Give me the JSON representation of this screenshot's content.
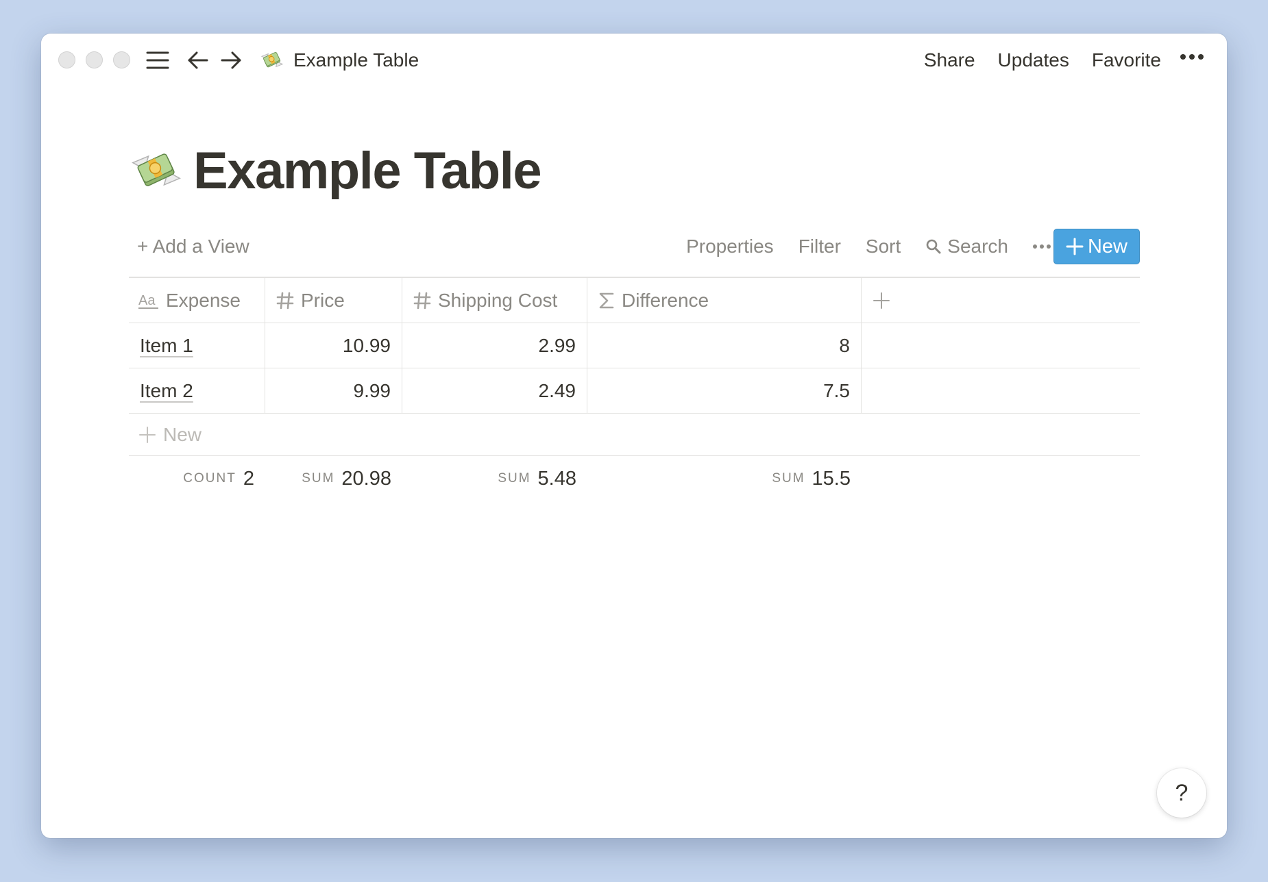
{
  "titlebar": {
    "page_emoji": "money-with-wings",
    "breadcrumb_title": "Example Table",
    "actions": {
      "share": "Share",
      "updates": "Updates",
      "favorite": "Favorite"
    }
  },
  "page": {
    "emoji": "money-with-wings",
    "title": "Example Table"
  },
  "toolbar": {
    "add_view": "+ Add a View",
    "properties": "Properties",
    "filter": "Filter",
    "sort": "Sort",
    "search": "Search",
    "new_button": "New",
    "accent_color": "#4aa3df"
  },
  "table": {
    "columns": [
      {
        "label": "Expense",
        "icon": "text-aa-icon"
      },
      {
        "label": "Price",
        "icon": "hash-icon"
      },
      {
        "label": "Shipping Cost",
        "icon": "hash-icon"
      },
      {
        "label": "Difference",
        "icon": "sigma-icon"
      }
    ],
    "rows": [
      {
        "expense": "Item 1",
        "price": "10.99",
        "shipping": "2.99",
        "difference": "8"
      },
      {
        "expense": "Item 2",
        "price": "9.99",
        "shipping": "2.49",
        "difference": "7.5"
      }
    ],
    "new_row_label": "New",
    "footer": {
      "expense": {
        "label": "COUNT",
        "value": "2"
      },
      "price": {
        "label": "SUM",
        "value": "20.98"
      },
      "shipping": {
        "label": "SUM",
        "value": "5.48"
      },
      "difference": {
        "label": "SUM",
        "value": "15.5"
      }
    }
  },
  "help": {
    "label": "?"
  }
}
